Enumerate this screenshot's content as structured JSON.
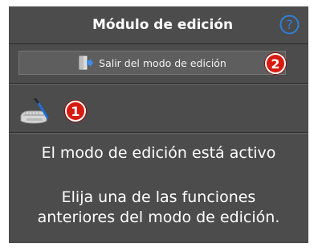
{
  "header": {
    "title": "Módulo de edición",
    "help_icon": "question-circle-icon"
  },
  "toolbar": {
    "exit_label": "Salir del modo de edición",
    "exit_icon": "exit-door-icon",
    "badge_exit": "2"
  },
  "tools": {
    "jaw_edit_icon": "jaw-edit-icon",
    "badge_tool": "1"
  },
  "status": {
    "active_message": "El modo de edición está activo",
    "instruction_line1": "Elija una de las funciones",
    "instruction_line2": "anteriores del modo de edición."
  },
  "colors": {
    "panel_bg": "#4c4c4c",
    "accent_blue": "#2f7fd6",
    "badge_red": "#d81b10"
  }
}
